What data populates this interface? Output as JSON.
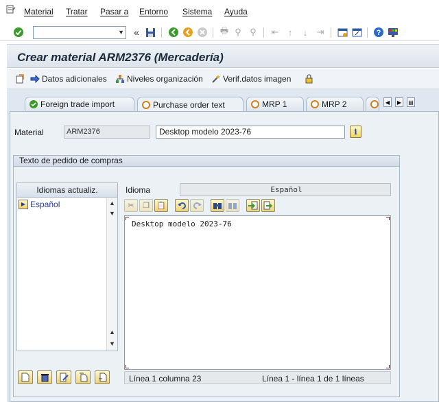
{
  "menubar": {
    "items": [
      "Material",
      "Tratar",
      "Pasar a",
      "Entorno",
      "Sistema",
      "Ayuda"
    ]
  },
  "toolbar": {
    "command_field": ""
  },
  "window": {
    "title": "Crear material ARM2376 (Mercadería)"
  },
  "app_toolbar": {
    "buttons": [
      "Datos adicionales",
      "Niveles organización",
      "Verif.datos imagen"
    ]
  },
  "tabs": {
    "items": [
      "Foreign trade import",
      "Purchase order text",
      "MRP 1",
      "MRP 2"
    ],
    "active": "Purchase order text"
  },
  "header": {
    "material_label": "Material",
    "material_value": "ARM2376",
    "description": "Desktop modelo 2023-76"
  },
  "group": {
    "title": "Texto de pedido de compras",
    "languages_header": "Idiomas actualiz.",
    "languages": [
      "Español"
    ],
    "idioma_label": "Idioma",
    "idioma_value": "Español"
  },
  "editor": {
    "text": "Desktop modelo 2023-76",
    "status_position": "Línea 1 columna 23",
    "status_lines": "Línea 1 - línea 1 de 1 líneas"
  },
  "colors": {
    "accent_blue": "#2a3ca0",
    "panel_bg": "#ecf1f6",
    "title_text": "#1b2a3a"
  }
}
